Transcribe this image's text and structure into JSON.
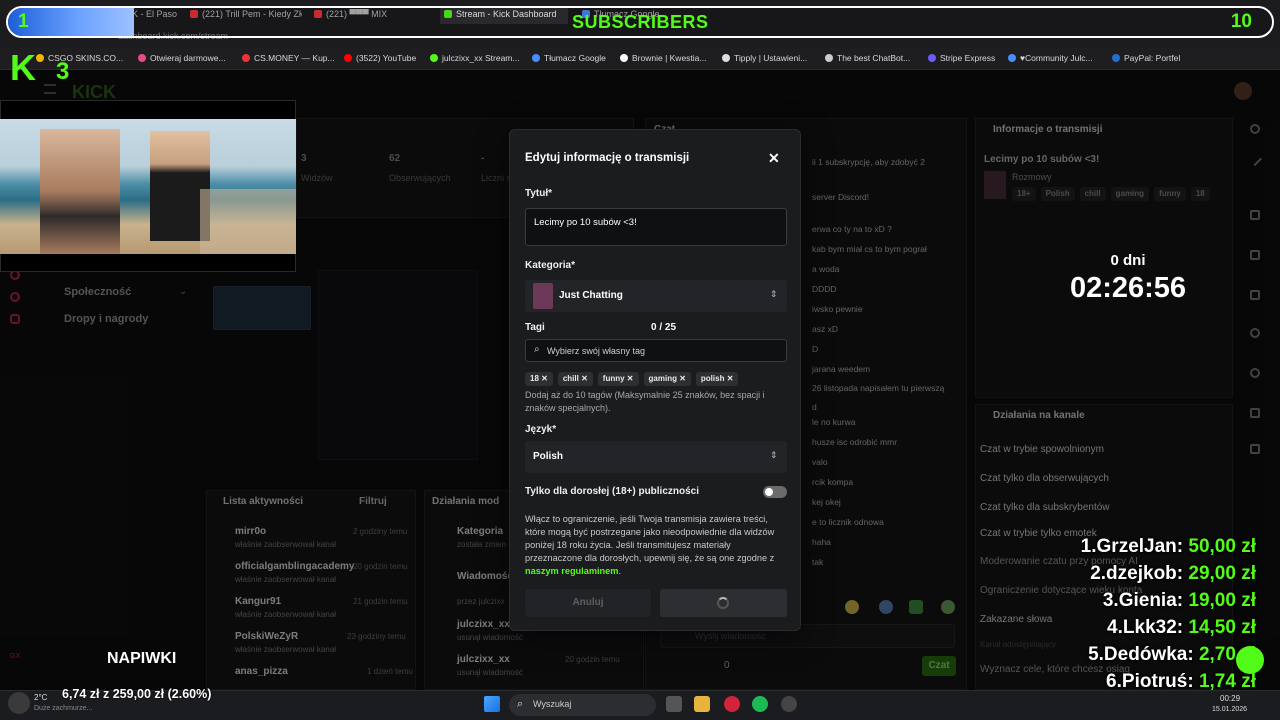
{
  "overlay": {
    "subs_current": "1",
    "subs_goal": "10",
    "subs_title": "SUBSCRIBERS",
    "subs_progress": 0.1,
    "kick_logo_text": "K",
    "kick_count": "3",
    "napiwki_label": "NAPIWKI",
    "timer_days": "0 dni",
    "timer": "02:26:56",
    "donation_goal": "6,74 zł z 259,00 zł (2.60%)",
    "leaderboard": [
      {
        "rank": "1.",
        "name": "GrzelJan:",
        "amount": "50,00 zł"
      },
      {
        "rank": "2.",
        "name": "dzejkob:",
        "amount": "29,00 zł"
      },
      {
        "rank": "3.",
        "name": "Gienia:",
        "amount": "19,00 zł"
      },
      {
        "rank": "4.",
        "name": "Lkk32:",
        "amount": "14,50 zł"
      },
      {
        "rank": "5.",
        "name": "Dedówka:",
        "amount": "2,70 zł"
      },
      {
        "rank": "6.",
        "name": "Piotruś:",
        "amount": "1,74 zł"
      }
    ]
  },
  "browser": {
    "tabs": [
      "K - El Paso",
      "(221) Trill Pem - Kiedy Zło",
      "(221) ▀▀▀ MIX",
      "Stream - Kick Dashboard",
      "Tłumacz Google"
    ],
    "url": "dashboard.kick.com/stream",
    "bookmarks": [
      "CSGO SKINS.CO...",
      "Otwieraj darmowe...",
      "CS.MONEY — Kup...",
      "(3522) YouTube",
      "julczixx_xx Stream...",
      "Tłumacz Google",
      "Brownie | Kwestia...",
      "Tipply | Ustawieni...",
      "The best ChatBot...",
      "Stripe Express",
      "♥Community Julc...",
      "PayPal: Portfel"
    ]
  },
  "dashboard": {
    "stats": [
      {
        "value": "3",
        "label": "Widzów"
      },
      {
        "value": "62",
        "label": "Obserwujących"
      },
      {
        "value": "-",
        "label": "Liczni subsk"
      }
    ],
    "nav": [
      "Społeczność",
      "Dropy i nagrody"
    ],
    "activity_title": "Lista aktywności",
    "activity_filter": "Filtruj",
    "activity": [
      {
        "name": "mirr0o",
        "sub": "właśnie zaobserwował kanał",
        "time": "2 godziny temu"
      },
      {
        "name": "officialgamblingacademy",
        "sub": "właśnie zaobserwował kanał",
        "time": "20 godzin temu"
      },
      {
        "name": "Kangur91",
        "sub": "właśnie zaobserwował kanał",
        "time": "21 godzin temu"
      },
      {
        "name": "PolskiWeZyR",
        "sub": "właśnie zaobserwował kanał",
        "time": "23 godziny temu"
      },
      {
        "name": "anas_pizza",
        "sub": "",
        "time": "1 dzień temu"
      }
    ],
    "mod_title": "Działania mod",
    "mod_items": [
      {
        "name": "Kategoria",
        "sub": "została zmien"
      },
      {
        "name": "Wiadomość odpięta",
        "sub": "przez julczixx"
      },
      {
        "name": "julczixx_xx",
        "sub": "usunął wiadomość"
      },
      {
        "name": "julczixx_xx",
        "sub": "usunął wiadomość",
        "time": "20 godzin temu"
      }
    ],
    "chat_title": "Czat",
    "chat_lines": [
      "ii 1 subskrypcję, aby zdobyć 2",
      "server Discord!",
      "erwa co ty na to xD ?",
      "kab bym miał cs to bym pograł",
      "a woda",
      "DDDD",
      "iwsko pewnie",
      "asz xD",
      "D",
      "jarana weedem",
      "26 listopada napisałem tu pierwszą",
      "d",
      "le no kurwa",
      "husze isc odrobić mmr",
      "valo",
      "rcik kompa",
      "kej okej",
      "e to licznik odnowa",
      "haha",
      "tak"
    ],
    "chat_placeholder": "Wyślij wiadomość",
    "chat_button": "Czat",
    "chat_count": "0",
    "info_title": "Informacje o transmisji",
    "info_stream_title": "Lecimy po 10 subów <3!",
    "info_category": "Rozmowy",
    "info_tags": [
      "18+",
      "Polish",
      "chill",
      "gaming",
      "funny",
      "18"
    ],
    "kanal_title": "Działania na kanale",
    "kanal_items": [
      "Czat w trybie spowolnionym",
      "Czat tylko dla obserwujących",
      "Czat tylko dla subskrybentów",
      "Czat w trybie tylko emotek",
      "Moderowanie czatu przy pomocy AI",
      "Ograniczenie dotyczące wieku konta",
      "Zakazane słowa",
      "Kanał odostępniający",
      "Wyznacz cele, które chcesz osiąg"
    ]
  },
  "modal": {
    "title": "Edytuj informację o transmisji",
    "title_label": "Tytuł*",
    "title_value": "Lecimy po 10 subów <3!",
    "category_label": "Kategoria*",
    "category_value": "Just Chatting",
    "tags_label": "Tagi",
    "tags_count": "0 / 25",
    "tags_placeholder": "Wybierz swój własny tag",
    "tags": [
      "18",
      "chill",
      "funny",
      "gaming",
      "polish"
    ],
    "tags_help": "Dodaj aż do 10 tagów (Maksymalnie 25 znaków, bez spacji i znaków specjalnych).",
    "lang_label": "Język*",
    "lang_value": "Polish",
    "adult_label": "Tylko dla dorosłej (18+) publiczności",
    "adult_text": "Włącz to ograniczenie, jeśli Twoja transmisja zawiera treści, które mogą być postrzegane jako nieodpowiednie dla widzów poniżej 18 roku życia. Jeśli transmitujesz materiały przeznaczone dla dorosłych, upewnij się, że są one zgodne z",
    "adult_link": "naszym regulaminem",
    "adult_end": ".",
    "cancel": "Anuluj"
  },
  "taskbar": {
    "weather": "2°C",
    "weather_sub": "Duże zachmurze...",
    "search": "Wyszukaj",
    "time": "00:29",
    "date": "15.01.2026"
  },
  "colors": {
    "accent": "#53fc18",
    "progress": "#3a7bff"
  }
}
